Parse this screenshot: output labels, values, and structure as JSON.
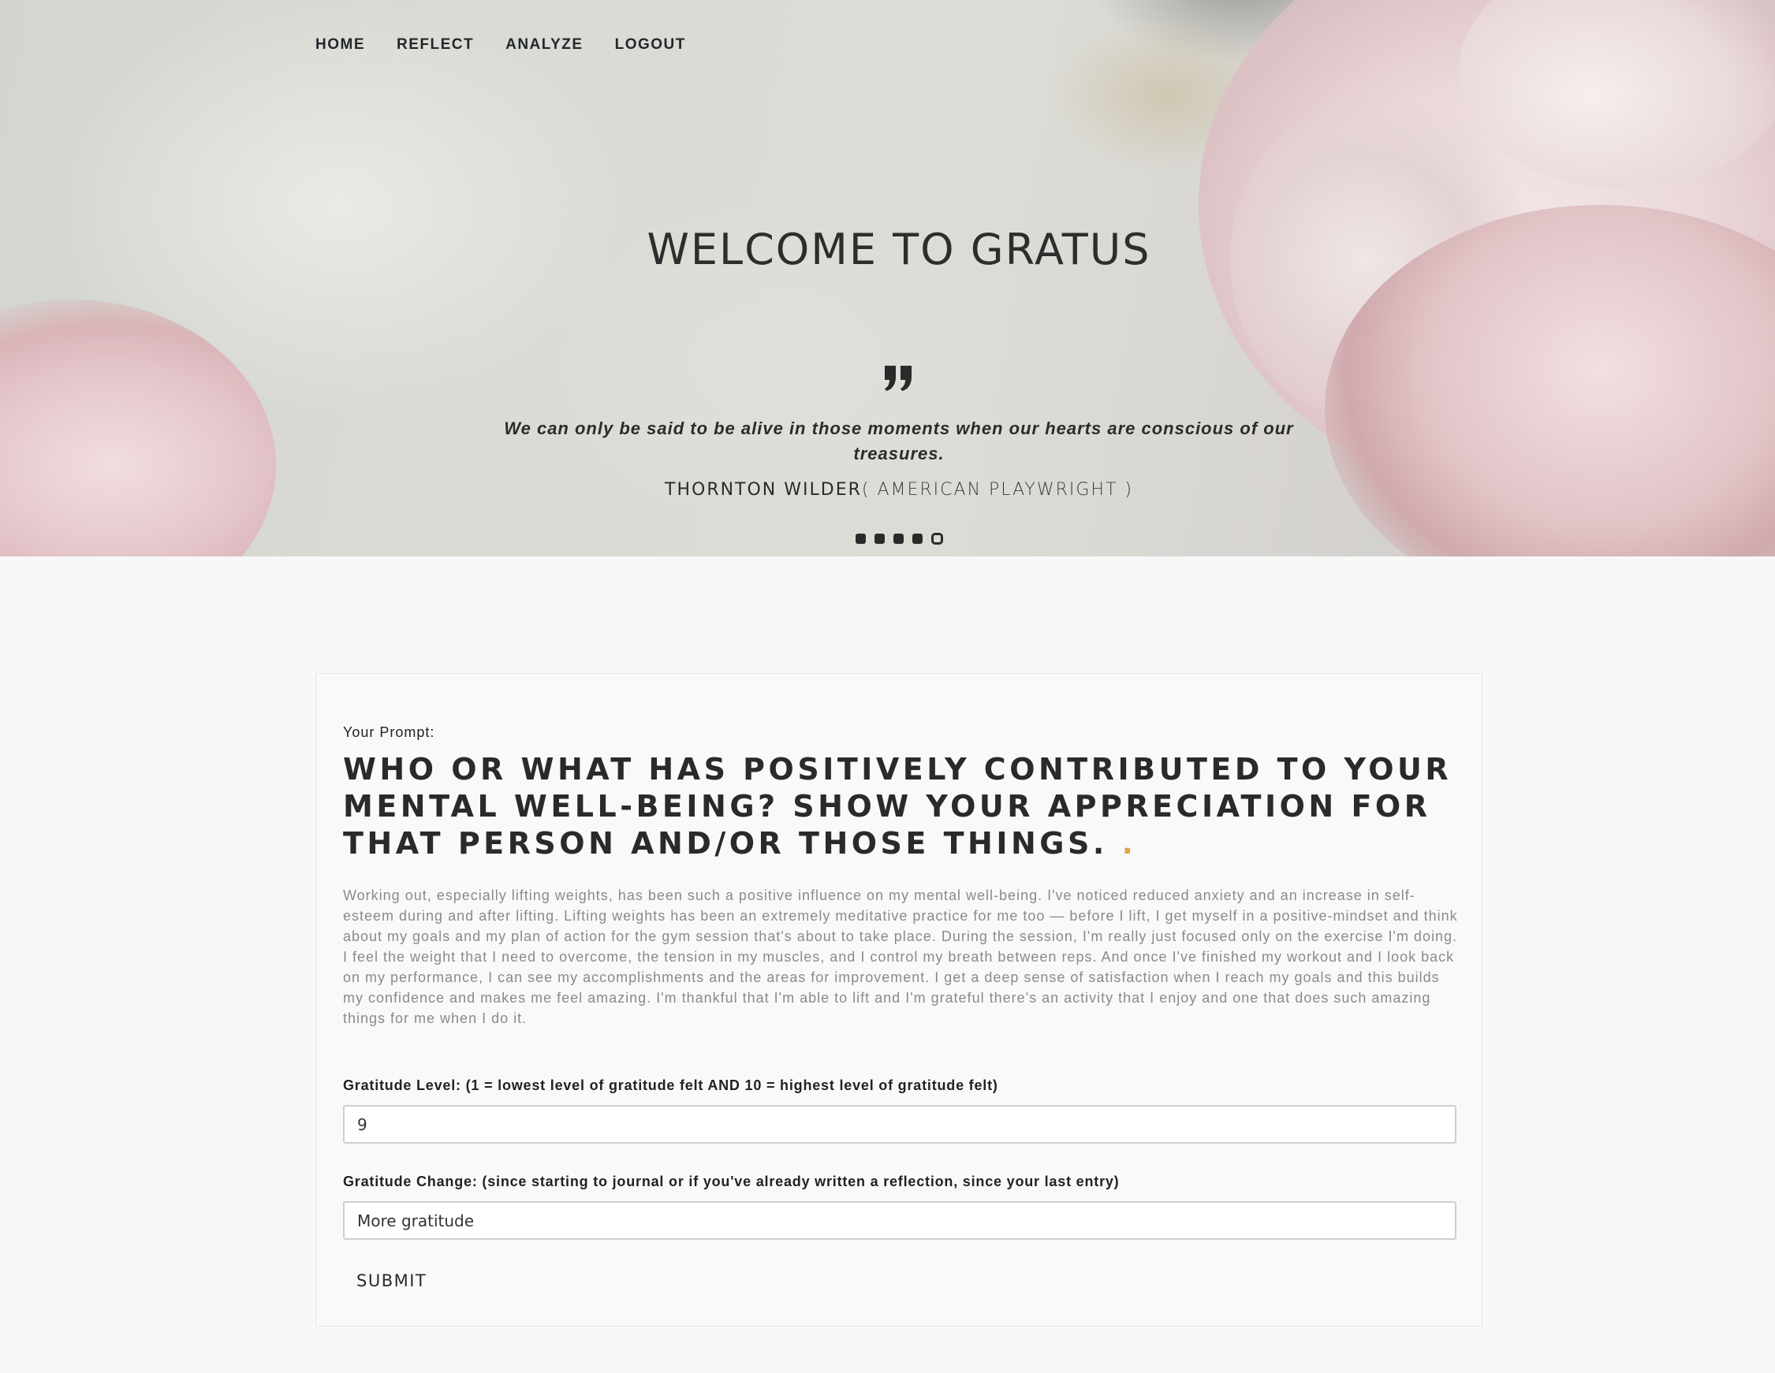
{
  "nav": {
    "items": [
      {
        "label": "HOME"
      },
      {
        "label": "REFLECT"
      },
      {
        "label": "ANALYZE"
      },
      {
        "label": "LOGOUT"
      }
    ]
  },
  "hero": {
    "title": "WELCOME TO GRATUS",
    "quote_icon": "quote-icon",
    "quote": "We can only be said to be alive in those moments when our hearts are conscious of our treasures.",
    "author": "THORNTON WILDER",
    "author_role": "( AMERICAN PLAYWRIGHT )",
    "slides": {
      "count": 5,
      "active_index": 4
    }
  },
  "form": {
    "prompt_label": "Your Prompt:",
    "prompt": "WHO OR WHAT HAS POSITIVELY CONTRIBUTED TO YOUR MENTAL WELL-BEING? SHOW YOUR APPRECIATION FOR THAT PERSON AND/OR THOSE THINGS.",
    "prompt_suffix": ".",
    "entry": "Working out, especially lifting weights, has been such a positive influence on my mental well-being. I've noticed reduced anxiety and an increase in self-esteem during and after lifting. Lifting weights has been an extremely meditative practice for me too — before I lift, I get myself in a positive-mindset and think about my goals and my plan of action for the gym session that's about to take place. During the session, I'm really just focused only on the exercise I'm doing. I feel the weight that I need to overcome, the tension in my muscles, and I control my breath between reps. And once I've finished my workout and I look back on my performance, I can see my accomplishments and the areas for improvement. I get a deep sense of satisfaction when I reach my goals and this builds my confidence and makes me feel amazing. I'm thankful that I'm able to lift and I'm grateful there's an activity that I enjoy and one that does such amazing things for me when I do it.",
    "gratitude_level_label": "Gratitude Level: (1 = lowest level of gratitude felt AND 10 = highest level of gratitude felt)",
    "gratitude_level_value": "9",
    "gratitude_change_label": "Gratitude Change: (since starting to journal or if you've already written a reflection, since your last entry)",
    "gratitude_change_value": "More gratitude",
    "submit_label": "SUBMIT"
  },
  "colors": {
    "accent": "#e0a84b",
    "text": "#2b2b2b",
    "page_bg": "#f8f8f8"
  }
}
